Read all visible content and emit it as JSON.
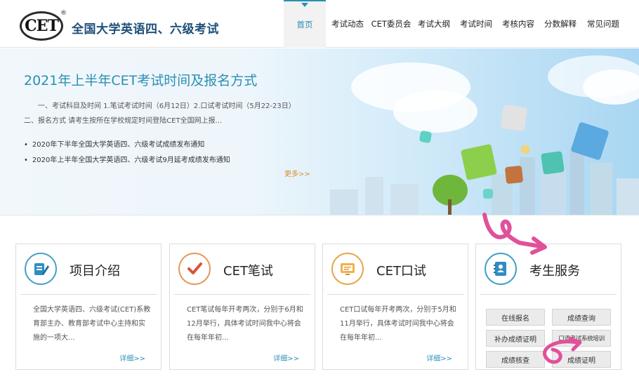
{
  "header": {
    "logo_text": "CET",
    "logo_reg": "®",
    "site_title": "全国大学英语四、六级考试",
    "nav": [
      {
        "label": "首页",
        "active": true
      },
      {
        "label": "考试动态"
      },
      {
        "label": "CET委员会"
      },
      {
        "label": "考试大纲"
      },
      {
        "label": "考试时间"
      },
      {
        "label": "考核内容"
      },
      {
        "label": "分数解释"
      },
      {
        "label": "常见问题"
      }
    ]
  },
  "banner": {
    "title": "2021年上半年CET考试时间及报名方式",
    "summary": "一、考试科目及时间 1.笔试考试时间（6月12日）2.口试考试时间（5月22-23日）二、报名方式   请考生按所在学校规定时间登陆CET全国网上报...",
    "news": [
      "2020年下半年全国大学英语四、六级考试成绩发布通知",
      "2020年上半年全国大学英语四、六级考试9月延考成绩发布通知"
    ],
    "more_label": "更多>>"
  },
  "cards": [
    {
      "title": "项目介绍",
      "icon": "document-edit-icon",
      "body": "全国大学英语四、六级考试(CET)系教育部主办、教育部考试中心主持和实施的一项大...",
      "more_label": "详细>>"
    },
    {
      "title": "CET笔试",
      "icon": "checkmark-icon",
      "body": "CET笔试每年开考两次，分别于6月和12月举行，具体考试时间我中心将会在每年年初...",
      "more_label": "详细>>"
    },
    {
      "title": "CET口试",
      "icon": "monitor-icon",
      "body": "CET口试每年开考两次，分别于5月和11月举行，具体考试时间我中心将会在每年年初...",
      "more_label": "详细>>"
    }
  ],
  "service": {
    "title": "考生服务",
    "icon": "contact-book-icon",
    "buttons": [
      "在线报名",
      "成绩查询",
      "补办成绩证明",
      "口语考试系统培训",
      "成绩核查",
      "成绩证明"
    ]
  },
  "colors": {
    "accent": "#2a8fb5",
    "brand": "#1f4f7a",
    "more": "#d98f2a"
  }
}
